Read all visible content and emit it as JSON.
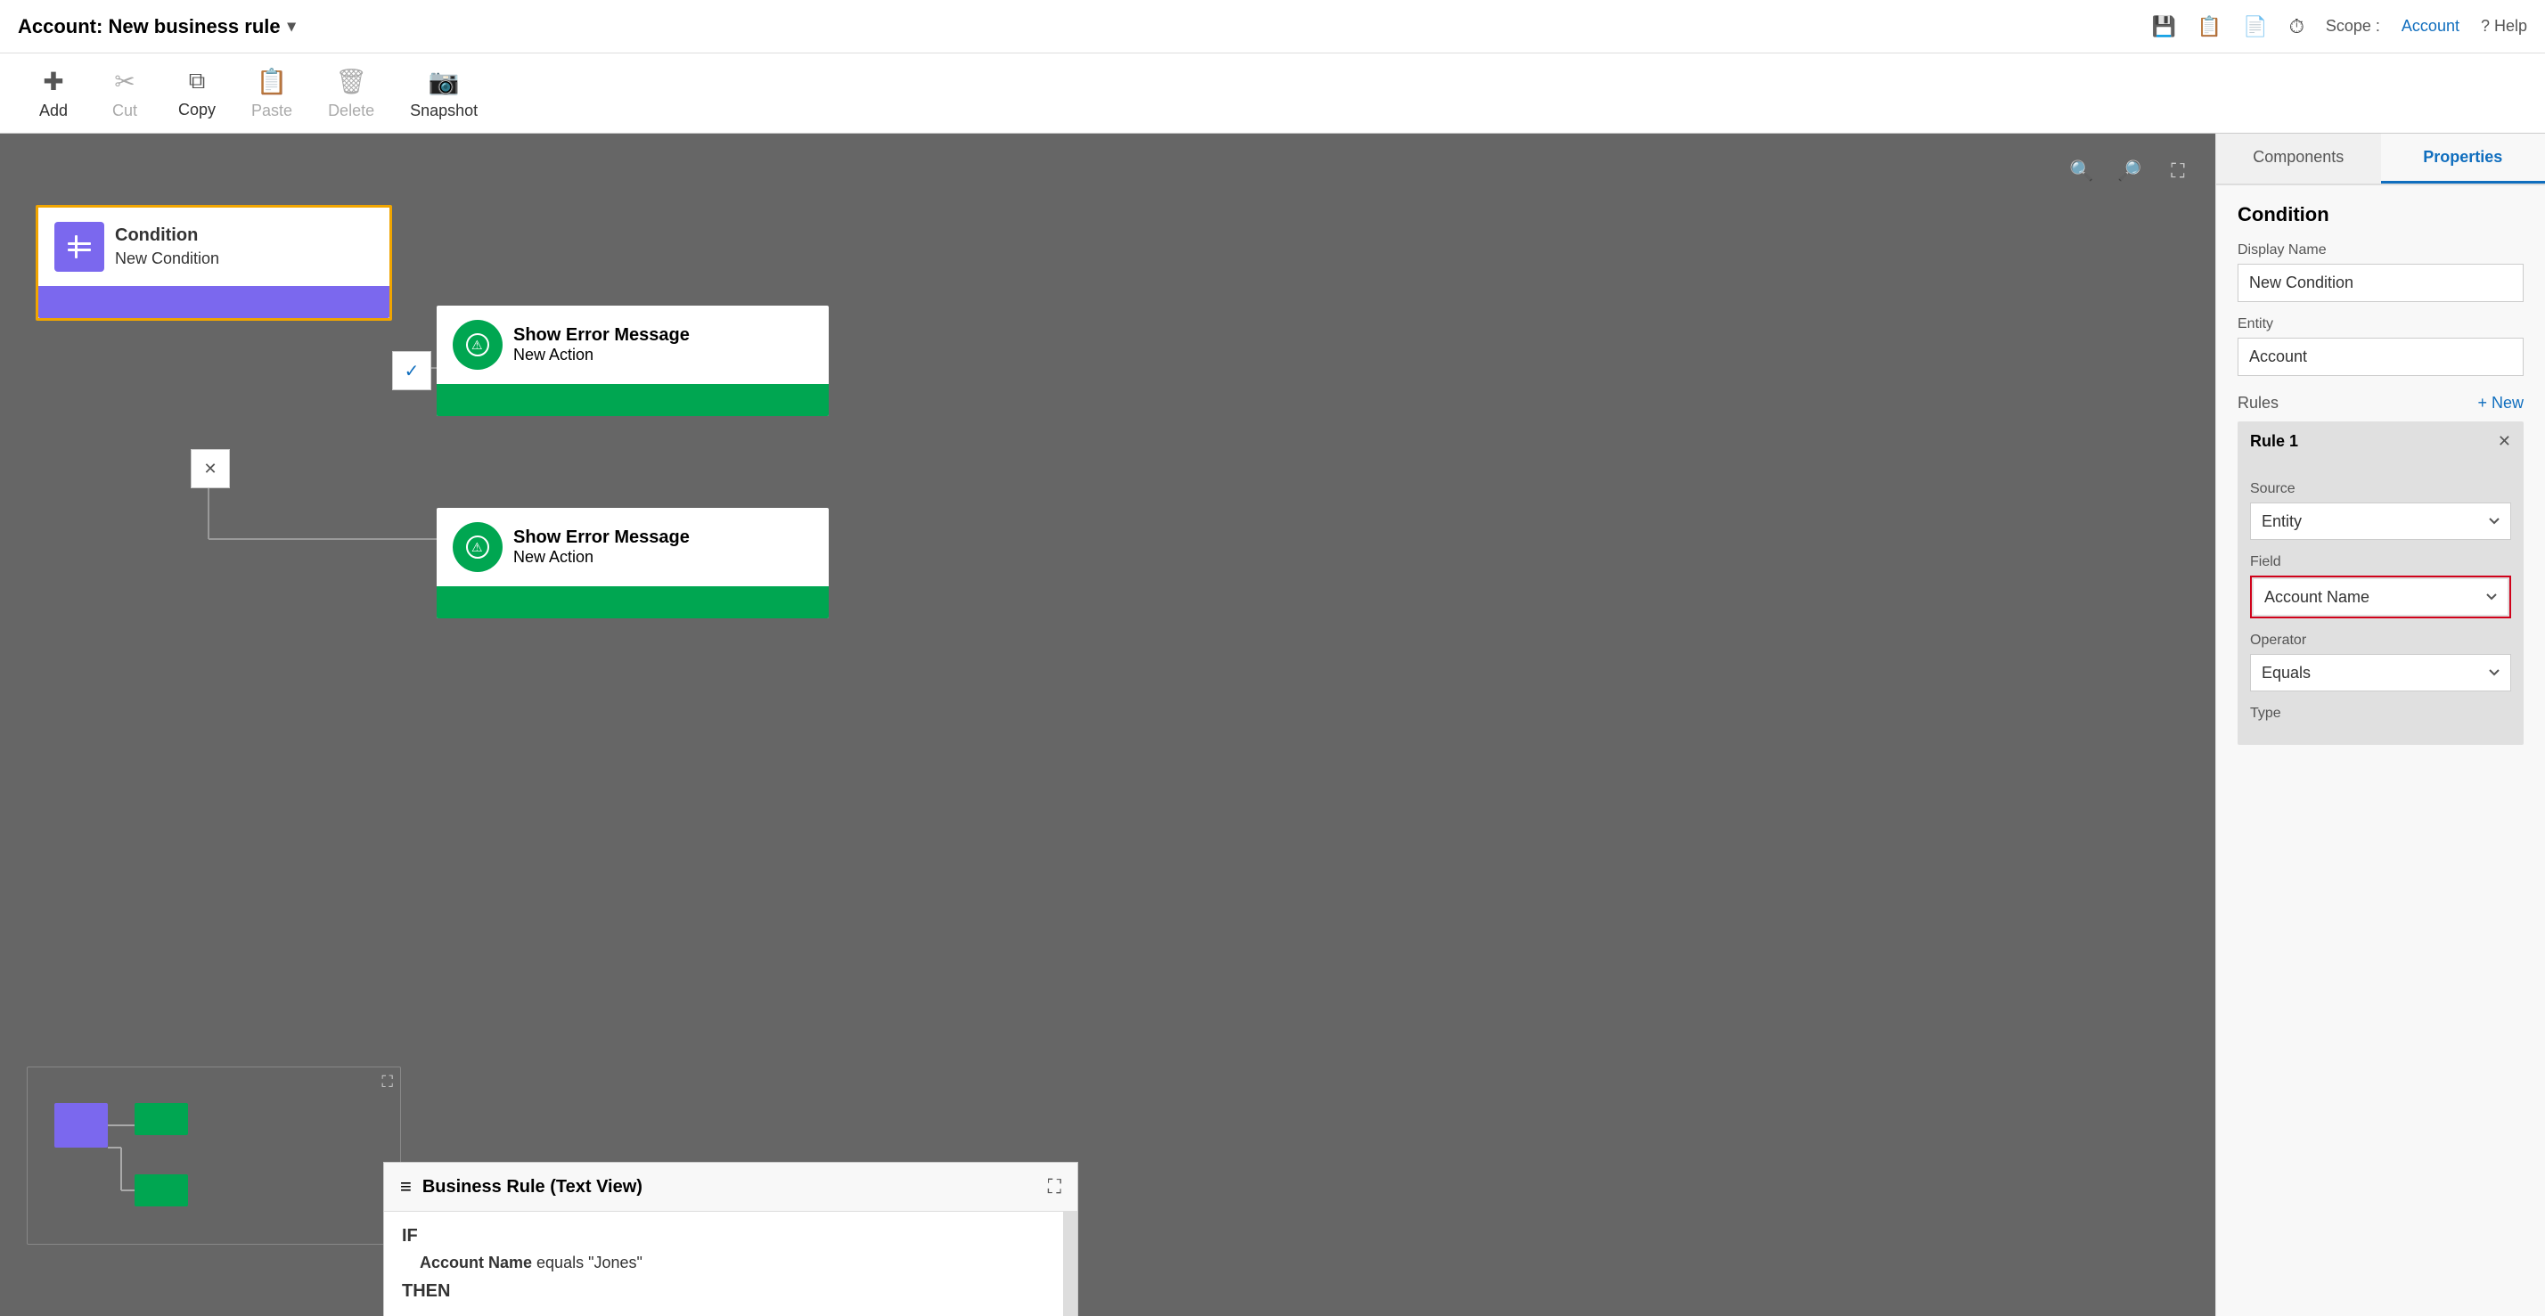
{
  "titleBar": {
    "title": "Account: New business rule",
    "dropdownIcon": "▾",
    "icons": [
      "💾",
      "📋",
      "📄",
      "⏱"
    ],
    "scopeLabel": "Scope :",
    "scopeValue": "Account",
    "helpLabel": "? Help"
  },
  "toolbar": {
    "items": [
      {
        "id": "add",
        "label": "Add",
        "icon": "+"
      },
      {
        "id": "cut",
        "label": "Cut",
        "icon": "✂"
      },
      {
        "id": "copy",
        "label": "Copy",
        "icon": "⧉"
      },
      {
        "id": "paste",
        "label": "Paste",
        "icon": "📋"
      },
      {
        "id": "delete",
        "label": "Delete",
        "icon": "🗑"
      },
      {
        "id": "snapshot",
        "label": "Snapshot",
        "icon": "📷"
      }
    ]
  },
  "canvas": {
    "zoomOut": "🔍−",
    "zoomIn": "🔍+",
    "expand": "⛶"
  },
  "conditionNode": {
    "label1": "Condition",
    "label2": "New Condition",
    "icon": "⊞"
  },
  "actionNodes": [
    {
      "label1": "Show Error Message",
      "label2": "New Action"
    },
    {
      "label1": "Show Error Message",
      "label2": "New Action"
    }
  ],
  "brPanel": {
    "title": "Business Rule (Text View)",
    "expandIcon": "⛶",
    "if": "IF",
    "then": "THEN",
    "ruleText": "Account Name equals \"Jones\"",
    "boldPart": "Account Name"
  },
  "rightPanel": {
    "tabs": [
      "Components",
      "Properties"
    ],
    "activeTab": 1,
    "sectionTitle": "Condition",
    "displayNameLabel": "Display Name",
    "displayNameValue": "New Condition",
    "entityLabel": "Entity",
    "entityValue": "Account",
    "rulesLabel": "Rules",
    "newBtnLabel": "+ New",
    "rule": {
      "title": "Rule 1",
      "closeIcon": "✕",
      "sourceLabel": "Source",
      "sourceValue": "Entity",
      "fieldLabel": "Field",
      "fieldValue": "Account Name",
      "operatorLabel": "Operator",
      "operatorValue": "Equals",
      "typeLabel": "Type"
    }
  }
}
